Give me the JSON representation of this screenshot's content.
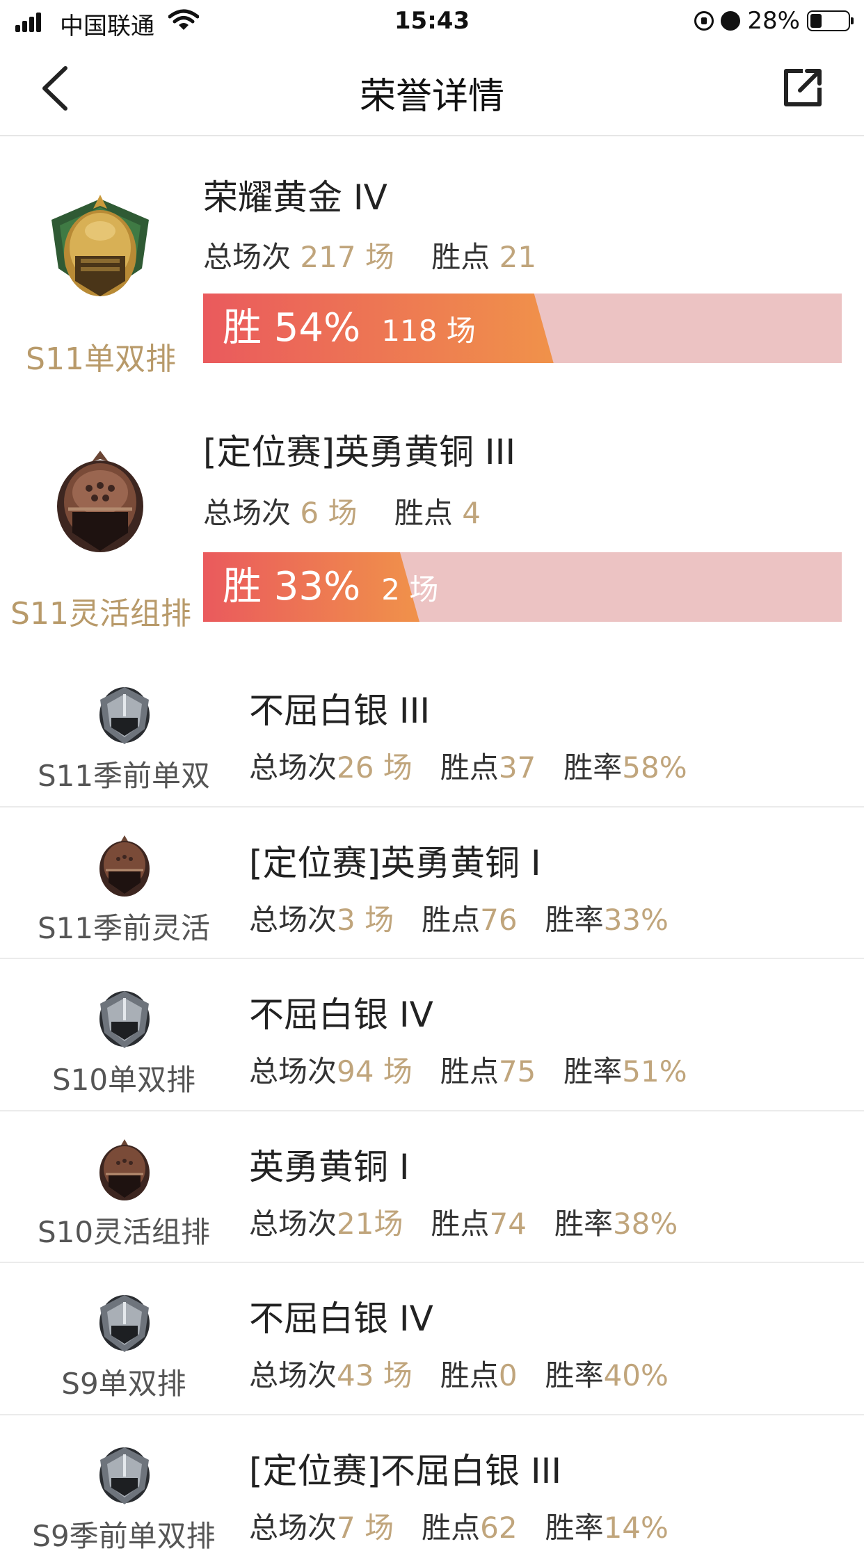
{
  "status_bar": {
    "carrier": "中国联通",
    "time": "15:43",
    "battery": "28%"
  },
  "nav": {
    "title": "荣誉详情",
    "back_icon": "chevron-left-icon",
    "share_icon": "share-external-icon"
  },
  "labels": {
    "total": "总场次",
    "points": "胜点",
    "rate": "胜率"
  },
  "featured": [
    {
      "season": "S11单双排",
      "rank": "荣耀黄金 IV",
      "total": "217 场",
      "points": "21",
      "win_pct": "胜 54%",
      "wins": "118 场",
      "win_fraction": 0.54,
      "tier": "gold"
    },
    {
      "season": "S11灵活组排",
      "rank": "[定位赛]英勇黄铜 III",
      "total": "6 场",
      "points": "4",
      "win_pct": "胜 33%",
      "wins": "2 场",
      "win_fraction": 0.33,
      "tier": "bronze"
    }
  ],
  "records": [
    {
      "season": "S11季前单双",
      "rank": "不屈白银 III",
      "total": "26 场",
      "points": "37",
      "rate": "58%",
      "tier": "silver"
    },
    {
      "season": "S11季前灵活",
      "rank": "[定位赛]英勇黄铜 I",
      "total": "3 场",
      "points": "76",
      "rate": "33%",
      "tier": "bronze"
    },
    {
      "season": "S10单双排",
      "rank": "不屈白银 IV",
      "total": "94 场",
      "points": "75",
      "rate": "51%",
      "tier": "silver"
    },
    {
      "season": "S10灵活组排",
      "rank": "英勇黄铜 I",
      "total": "21场",
      "points": "74",
      "rate": "38%",
      "tier": "bronze"
    },
    {
      "season": "S9单双排",
      "rank": "不屈白银 IV",
      "total": "43 场",
      "points": "0",
      "rate": "40%",
      "tier": "silver"
    },
    {
      "season": "S9季前单双排",
      "rank": "[定位赛]不屈白银 III",
      "total": "7 场",
      "points": "62",
      "rate": "14%",
      "tier": "silver"
    }
  ],
  "colors": {
    "accent_gold": "#c0a57c",
    "bar_start": "#ea5a5d",
    "bar_end": "#f0924a",
    "bar_track": "#ecc3c3"
  }
}
